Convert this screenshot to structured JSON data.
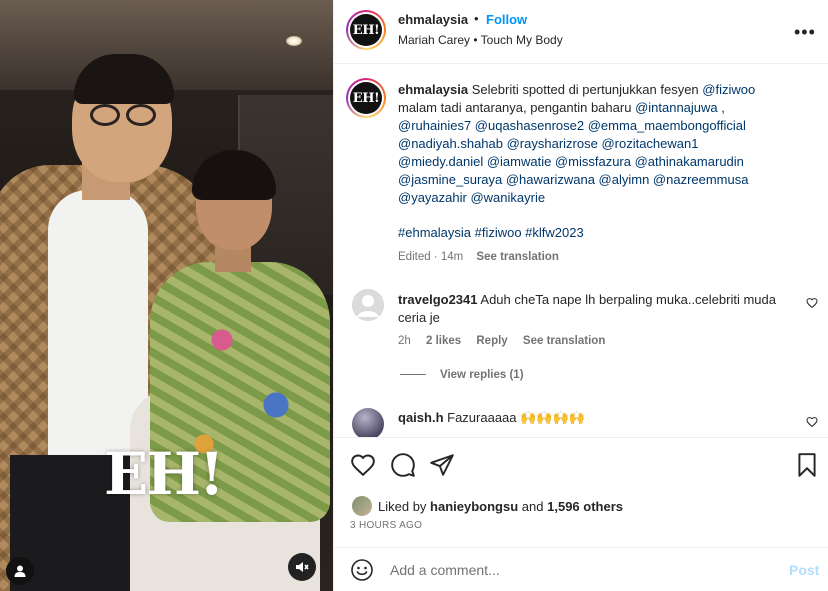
{
  "media": {
    "watermark": "EH!"
  },
  "header": {
    "username": "ehmalaysia",
    "dot": "•",
    "follow_label": "Follow",
    "song": "Mariah Carey • Touch My Body",
    "avatar_text": "EH!"
  },
  "caption": {
    "username": "ehmalaysia",
    "avatar_text": "EH!",
    "line1_text": "Selebriti spotted di pertunjukkan fesyen",
    "line1_mention": "@fiziwoo",
    "line2_text": "malam tadi antaranya, pengantin baharu",
    "line2_mention": "@intannajuwa",
    "line2_suffix": ",",
    "mentions_line3": "@ruhainies7 @uqashasenrose2 @emma_maembongofficial",
    "mentions_line4": "@nadiyah.shahab @raysharizrose @rozitachewan1",
    "mentions_line5": "@miedy.daniel @iamwatie @missfazura @athinakamarudin",
    "mentions_line6": "@jasmine_suraya @hawarizwana @alyimn @nazreemmusa",
    "mentions_line7": "@yayazahir @wanikayrie",
    "hashtags": "#ehmalaysia #fiziwoo #klfw2023",
    "edited": "Edited · 14m",
    "see_translation": "See translation"
  },
  "comments": [
    {
      "username": "travelgo2341",
      "text": "Aduh cheTa nape lh berpaling muka..celebriti muda ceria je",
      "time": "2h",
      "likes": "2 likes",
      "reply": "Reply",
      "see_translation": "See translation",
      "view_replies": "View replies (1)"
    },
    {
      "username": "qaish.h",
      "text": "Fazuraaaaa 🙌🙌🙌🙌"
    }
  ],
  "likes": {
    "prefix": "Liked by",
    "user": "hanieybongsu",
    "and": "and",
    "others": "1,596 others"
  },
  "timestamp": "3 HOURS AGO",
  "add_comment": {
    "placeholder": "Add a comment...",
    "post_label": "Post"
  },
  "colors": {
    "link_blue": "#0095f6",
    "mention": "#00376b",
    "muted": "#737373"
  }
}
